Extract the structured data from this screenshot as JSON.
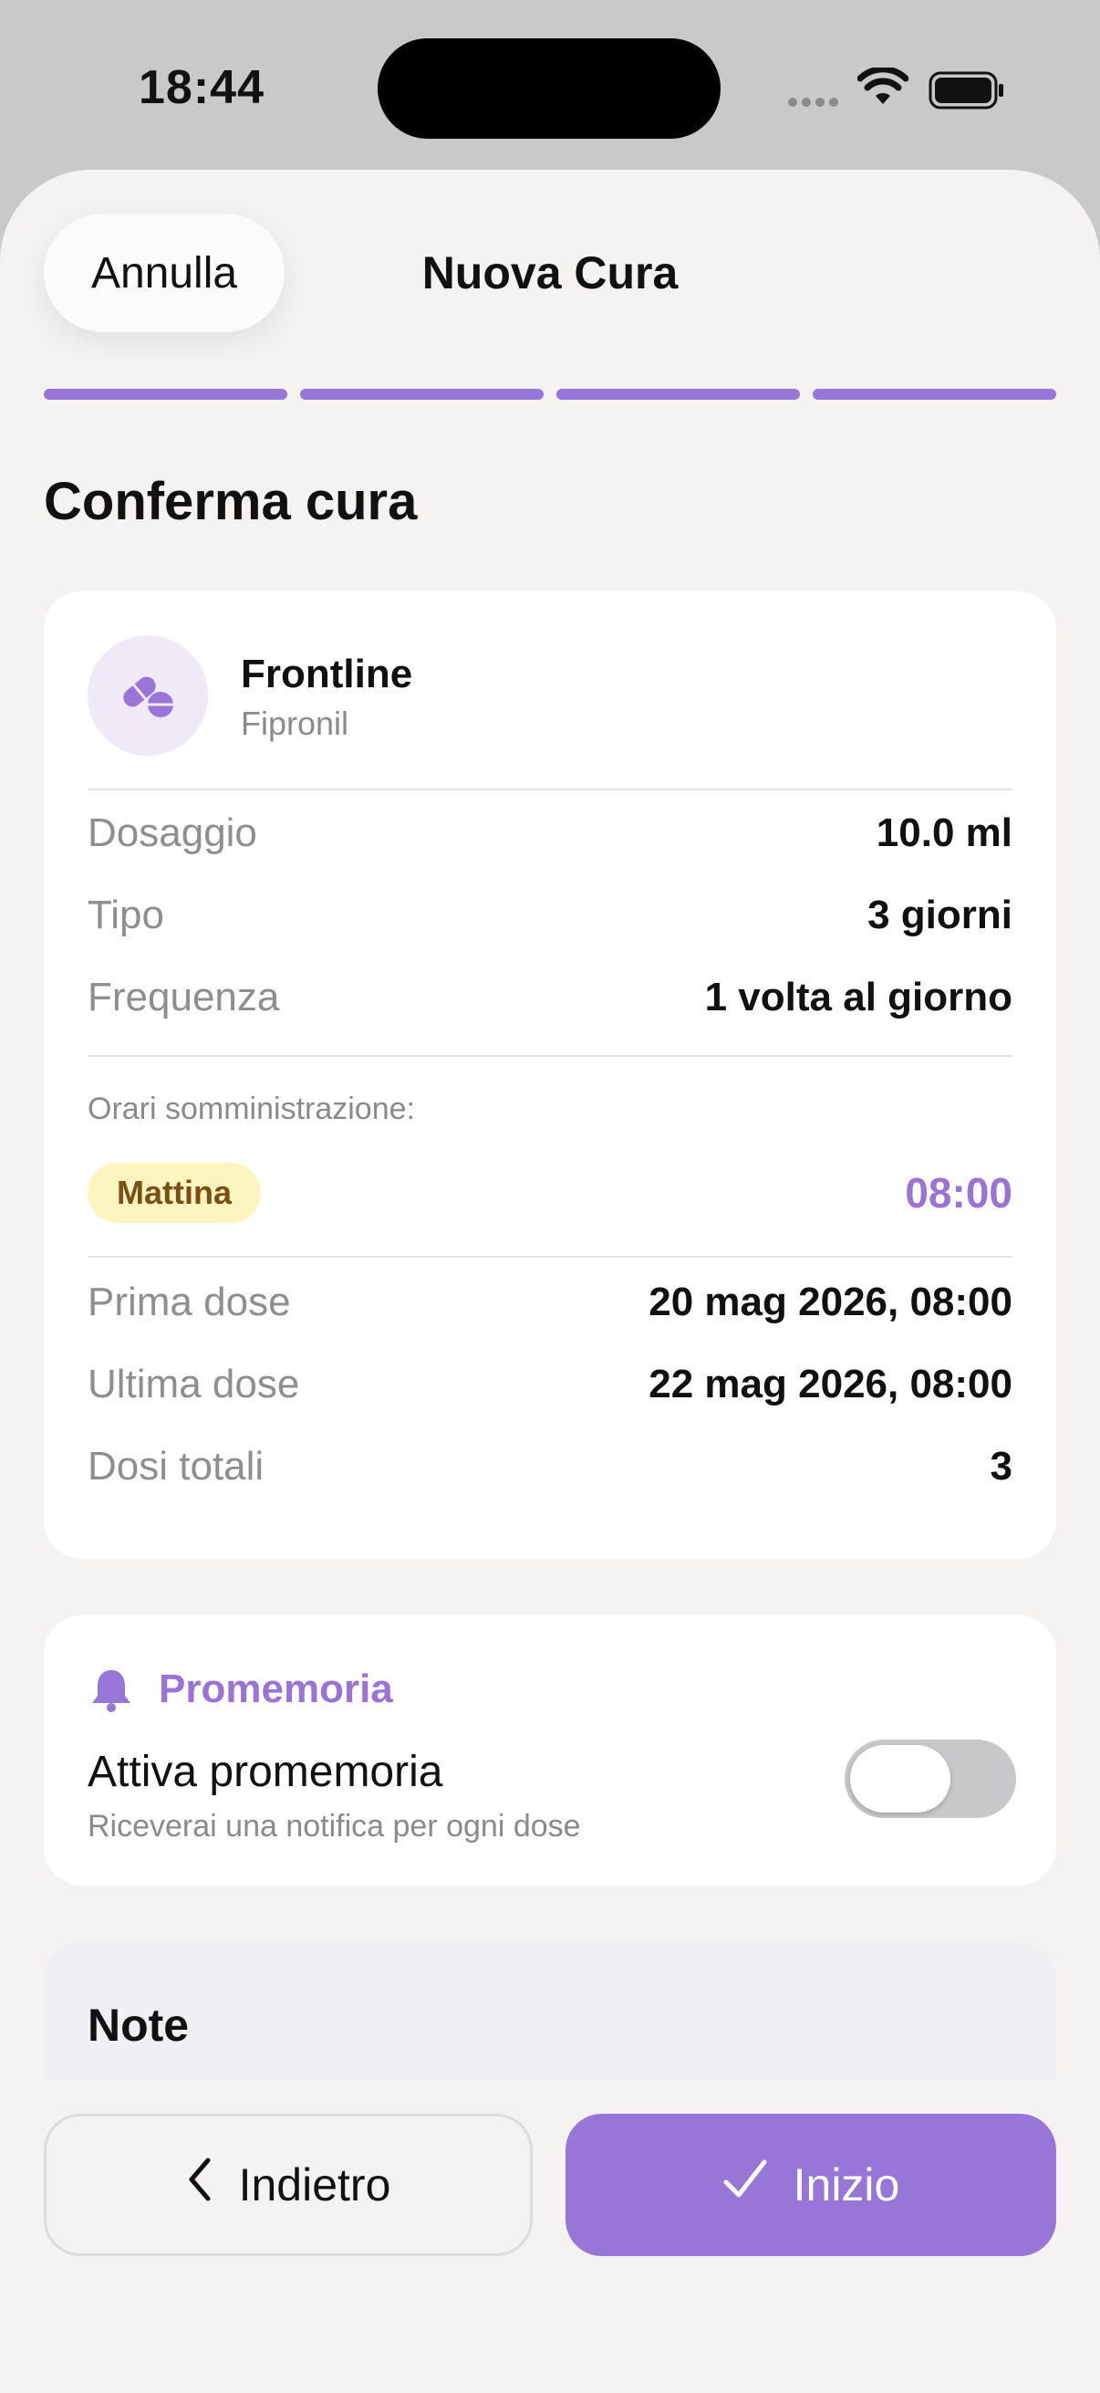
{
  "status_bar": {
    "time": "18:44"
  },
  "header": {
    "cancel_label": "Annulla",
    "title": "Nuova Cura"
  },
  "progress": {
    "steps_total": 4,
    "steps_completed": 4
  },
  "section_heading": "Conferma cura",
  "medication": {
    "name": "Frontline",
    "active_ingredient": "Fipronil",
    "icon": "pill-icon"
  },
  "details": [
    {
      "label": "Dosaggio",
      "value": "10.0 ml"
    },
    {
      "label": "Tipo",
      "value": "3 giorni"
    },
    {
      "label": "Frequenza",
      "value": "1 volta al giorno"
    }
  ],
  "schedule": {
    "caption": "Orari somministrazione:",
    "slot_label": "Mattina",
    "slot_time": "08:00"
  },
  "dates": [
    {
      "label": "Prima dose",
      "value": "20 mag 2026, 08:00"
    },
    {
      "label": "Ultima dose",
      "value": "22 mag 2026, 08:00"
    },
    {
      "label": "Dosi totali",
      "value": "3"
    }
  ],
  "reminder": {
    "title": "Promemoria",
    "label": "Attiva promemoria",
    "description": "Riceverai una notifica per ogni dose",
    "enabled": false
  },
  "notes": {
    "title": "Note"
  },
  "footer": {
    "back_label": "Indietro",
    "start_label": "Inizio"
  },
  "colors": {
    "accent": "#9876d8",
    "badge_bg": "#fdf5bf",
    "badge_text": "#7a4e14",
    "background": "#f4f3f1"
  }
}
